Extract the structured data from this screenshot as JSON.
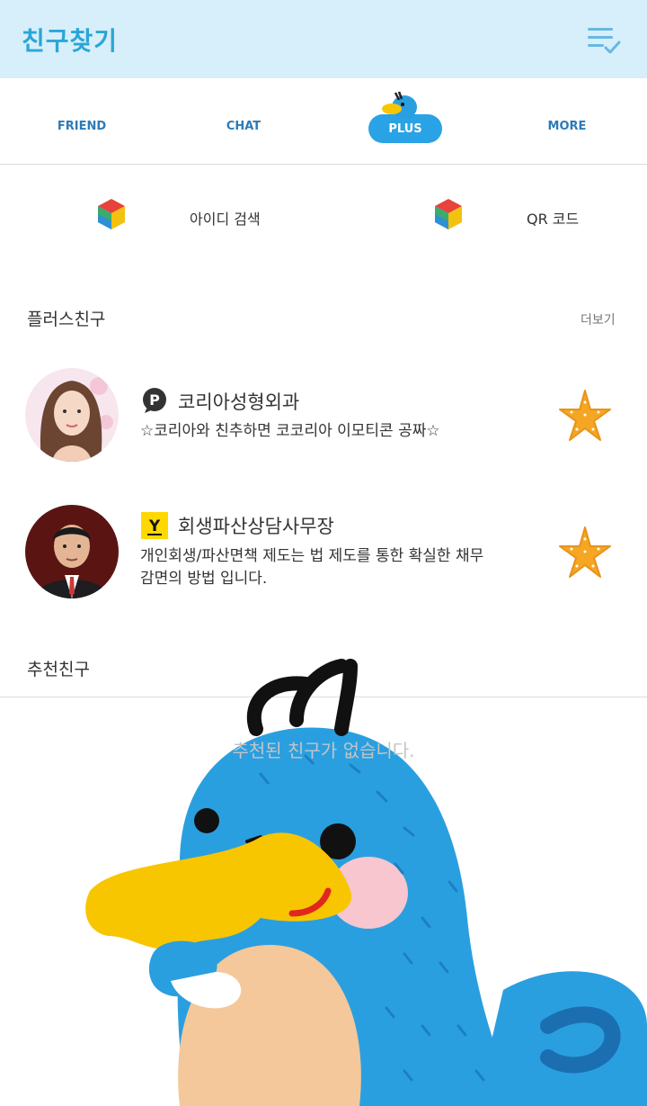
{
  "header": {
    "title": "친구찾기",
    "menu_icon": "list-check-icon"
  },
  "tabs": [
    {
      "label": "FRIEND"
    },
    {
      "label": "CHAT"
    },
    {
      "label": "PLUS",
      "active": true
    },
    {
      "label": "MORE"
    }
  ],
  "quick_actions": [
    {
      "label": "아이디 검색",
      "icon": "cube-icon"
    },
    {
      "label": "QR 코드",
      "icon": "cube-icon"
    }
  ],
  "plus_friends": {
    "title": "플러스친구",
    "more": "더보기",
    "items": [
      {
        "name": "코리아성형외과",
        "badge": "P",
        "desc": "☆코리아와 친추하면 코코리아 이모티콘 공짜☆"
      },
      {
        "name": "회생파산상담사무장",
        "badge": "Y",
        "desc": "개인회생/파산면책 제도는 법 제도를 통한  확실한 채무감면의  방법 입니다."
      }
    ]
  },
  "recommended": {
    "title": "추천친구",
    "empty": "추천된 친구가 없습니다."
  },
  "colors": {
    "header_bg": "#d7eefb",
    "accent": "#2aa6d6",
    "tab_text": "#2b7bb9",
    "plus_active": "#29a3e6",
    "star": "#f5a623",
    "mascot_blue": "#2a9fe0",
    "mascot_bill": "#f7c600"
  }
}
